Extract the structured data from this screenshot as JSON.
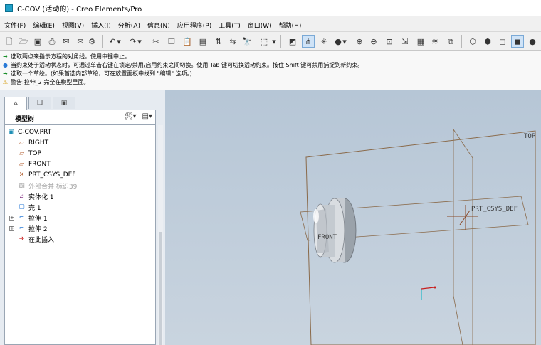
{
  "window": {
    "title": "C-COV (活动的) - Creo Elements/Pro"
  },
  "menubar": {
    "items": [
      "文件(F)",
      "编辑(E)",
      "视图(V)",
      "插入(I)",
      "分析(A)",
      "信息(N)",
      "应用程序(P)",
      "工具(T)",
      "窗口(W)",
      "帮助(H)"
    ]
  },
  "messages": [
    {
      "icon": "arrow-right-icon",
      "text": "选取两点来指示方程的对角线。使用中键中止。"
    },
    {
      "icon": "info-dot-icon",
      "text": "当约束处于活动状态时，可通过单击右键在锁定/禁用/启用约束之间切换。使用 Tab 键可切换活动约束。按住 Shift 键可禁用捕捉到新约束。"
    },
    {
      "icon": "arrow-right-icon",
      "text": "选取一个草绘。(如果首选内部草绘，可在放置面板中找到 \"编辑\" 选项。)"
    },
    {
      "icon": "warning-icon",
      "text": "警告:拉伸_2 完全在模型里面。"
    }
  ],
  "model_tree": {
    "title": "模型树",
    "items": [
      {
        "label": "C-COV.PRT",
        "icon": "part-icon",
        "dim": false
      },
      {
        "label": "RIGHT",
        "icon": "datum-plane-icon",
        "dim": false
      },
      {
        "label": "TOP",
        "icon": "datum-plane-icon",
        "dim": false
      },
      {
        "label": "FRONT",
        "icon": "datum-plane-icon",
        "dim": false
      },
      {
        "label": "PRT_CSYS_DEF",
        "icon": "csys-icon",
        "dim": false
      },
      {
        "label": "外部合并 标识39",
        "icon": "merge-icon",
        "dim": true
      },
      {
        "label": "实体化 1",
        "icon": "solidify-icon",
        "dim": false
      },
      {
        "label": "壳 1",
        "icon": "shell-icon",
        "dim": false
      },
      {
        "label": "拉伸 1",
        "icon": "extrude-icon",
        "dim": false
      },
      {
        "label": "拉伸 2",
        "icon": "extrude-icon",
        "dim": false
      },
      {
        "label": "在此插入",
        "icon": "insert-here-icon",
        "dim": false
      }
    ]
  },
  "viewport": {
    "labels": {
      "top_plane": "TOP",
      "csys": "PRT_CSYS_DEF",
      "front_plane": "FRONT"
    },
    "colors": {
      "background_top": "#b6c6d6",
      "datum_plane": "#8a6a4a",
      "model_body": "#b9bfc6"
    }
  }
}
